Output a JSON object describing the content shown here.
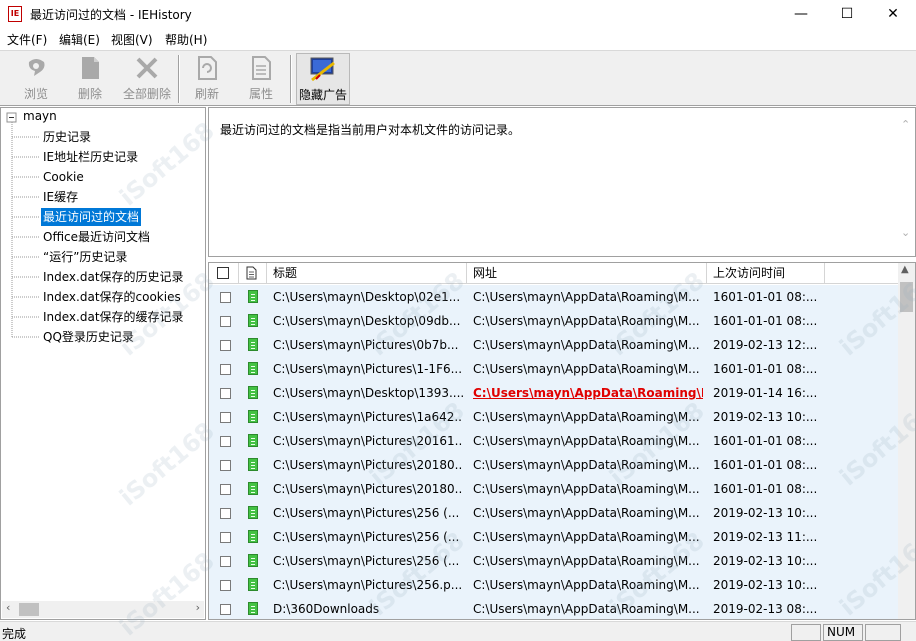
{
  "window": {
    "title": "最近访问过的文档 - IEHistory",
    "app_icon_text": "IE",
    "minimize_glyph": "—",
    "maximize_glyph": "☐",
    "close_glyph": "✕"
  },
  "menu": [
    "文件(F)",
    "编辑(E)",
    "视图(V)",
    "帮助(H)"
  ],
  "toolbar": {
    "browse": "浏览",
    "delete": "删除",
    "delete_all": "全部删除",
    "refresh": "刷新",
    "properties": "属性",
    "hide_ads": "隐藏广告"
  },
  "tree": {
    "root": "mayn",
    "items": [
      "历史记录",
      "IE地址栏历史记录",
      "Cookie",
      "IE缓存",
      "最近访问过的文档",
      "Office最近访问文档",
      "“运行”历史记录",
      "Index.dat保存的历史记录",
      "Index.dat保存的cookies",
      "Index.dat保存的缓存记录",
      "QQ登录历史记录"
    ],
    "selected_index": 4
  },
  "description": "最近访问过的文档是指当前用户对本机文件的访问记录。",
  "list": {
    "columns": [
      "标题",
      "网址",
      "上次访问时间"
    ],
    "rows": [
      {
        "title": "C:\\Users\\mayn\\Desktop\\02e1...",
        "url": "C:\\Users\\mayn\\AppData\\Roaming\\M...",
        "time": "1601-01-01  08:..."
      },
      {
        "title": "C:\\Users\\mayn\\Desktop\\09db...",
        "url": "C:\\Users\\mayn\\AppData\\Roaming\\M...",
        "time": "1601-01-01  08:..."
      },
      {
        "title": "C:\\Users\\mayn\\Pictures\\0b7b...",
        "url": "C:\\Users\\mayn\\AppData\\Roaming\\M...",
        "time": "2019-02-13  12:..."
      },
      {
        "title": "C:\\Users\\mayn\\Pictures\\1-1F6...",
        "url": "C:\\Users\\mayn\\AppData\\Roaming\\M...",
        "time": "1601-01-01  08:..."
      },
      {
        "title": "C:\\Users\\mayn\\Desktop\\1393....",
        "url": "C:\\Users\\mayn\\AppData\\Roaming\\M...",
        "time": "2019-01-14  16:...",
        "highlight": true
      },
      {
        "title": "C:\\Users\\mayn\\Pictures\\1a642...",
        "url": "C:\\Users\\mayn\\AppData\\Roaming\\M...",
        "time": "2019-02-13  10:..."
      },
      {
        "title": "C:\\Users\\mayn\\Pictures\\20161...",
        "url": "C:\\Users\\mayn\\AppData\\Roaming\\M...",
        "time": "1601-01-01  08:..."
      },
      {
        "title": "C:\\Users\\mayn\\Pictures\\20180...",
        "url": "C:\\Users\\mayn\\AppData\\Roaming\\M...",
        "time": "1601-01-01  08:..."
      },
      {
        "title": "C:\\Users\\mayn\\Pictures\\20180...",
        "url": "C:\\Users\\mayn\\AppData\\Roaming\\M...",
        "time": "1601-01-01  08:..."
      },
      {
        "title": "C:\\Users\\mayn\\Pictures\\256 (...",
        "url": "C:\\Users\\mayn\\AppData\\Roaming\\M...",
        "time": "2019-02-13  10:..."
      },
      {
        "title": "C:\\Users\\mayn\\Pictures\\256 (...",
        "url": "C:\\Users\\mayn\\AppData\\Roaming\\M...",
        "time": "2019-02-13  11:..."
      },
      {
        "title": "C:\\Users\\mayn\\Pictures\\256 (...",
        "url": "C:\\Users\\mayn\\AppData\\Roaming\\M...",
        "time": "2019-02-13  10:..."
      },
      {
        "title": "C:\\Users\\mayn\\Pictures\\256.p...",
        "url": "C:\\Users\\mayn\\AppData\\Roaming\\M...",
        "time": "2019-02-13  10:..."
      },
      {
        "title": "D:\\360Downloads",
        "url": "C:\\Users\\mayn\\AppData\\Roaming\\M...",
        "time": "2019-02-13  08:..."
      }
    ]
  },
  "status": {
    "text": "完成",
    "num": "NUM"
  },
  "colors": {
    "selection": "#0078d7",
    "row_bg": "#eaf3fb",
    "highlight_link": "#e00000",
    "doc_icon": "#43c143"
  },
  "watermark": "iSoft168"
}
